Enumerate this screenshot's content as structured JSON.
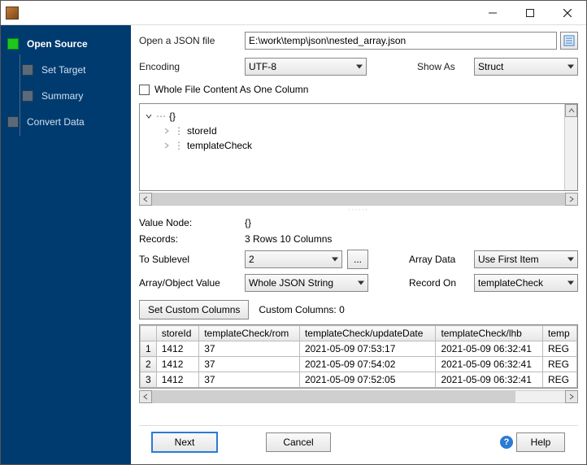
{
  "sidebar": {
    "items": [
      {
        "label": "Open Source"
      },
      {
        "label": "Set Target"
      },
      {
        "label": "Summary"
      },
      {
        "label": "Convert Data"
      }
    ]
  },
  "labels": {
    "open_json": "Open a JSON file",
    "encoding": "Encoding",
    "show_as": "Show As",
    "whole_file": "Whole File Content As One Column",
    "value_node": "Value Node:",
    "value_node_val": "{}",
    "records": "Records:",
    "records_val": "3 Rows   10 Columns",
    "to_sublevel": "To Sublevel",
    "ellipsis": "...",
    "array_data": "Array Data",
    "array_obj_value": "Array/Object Value",
    "record_on": "Record On",
    "set_custom_cols": "Set Custom Columns",
    "custom_cols": "Custom Columns: 0"
  },
  "inputs": {
    "file_path": "E:\\work\\temp\\json\\nested_array.json",
    "encoding": "UTF-8",
    "show_as": "Struct",
    "sublevel": "2",
    "array_data": "Use First Item",
    "array_obj_value": "Whole JSON String",
    "record_on": "templateCheck"
  },
  "tree": {
    "root": "{}",
    "children": [
      "storeId",
      "templateCheck"
    ]
  },
  "table": {
    "headers": [
      "storeId",
      "templateCheck/rom",
      "templateCheck/updateDate",
      "templateCheck/lhb",
      "temp"
    ],
    "rows": [
      {
        "n": "1",
        "storeId": "1412",
        "rom": "37",
        "upd": "2021-05-09 07:53:17",
        "lhb": "2021-05-09 06:32:41",
        "t": "REG"
      },
      {
        "n": "2",
        "storeId": "1412",
        "rom": "37",
        "upd": "2021-05-09 07:54:02",
        "lhb": "2021-05-09 06:32:41",
        "t": "REG"
      },
      {
        "n": "3",
        "storeId": "1412",
        "rom": "37",
        "upd": "2021-05-09 07:52:05",
        "lhb": "2021-05-09 06:32:41",
        "t": "REG"
      }
    ]
  },
  "footer": {
    "next": "Next",
    "cancel": "Cancel",
    "help": "Help"
  }
}
